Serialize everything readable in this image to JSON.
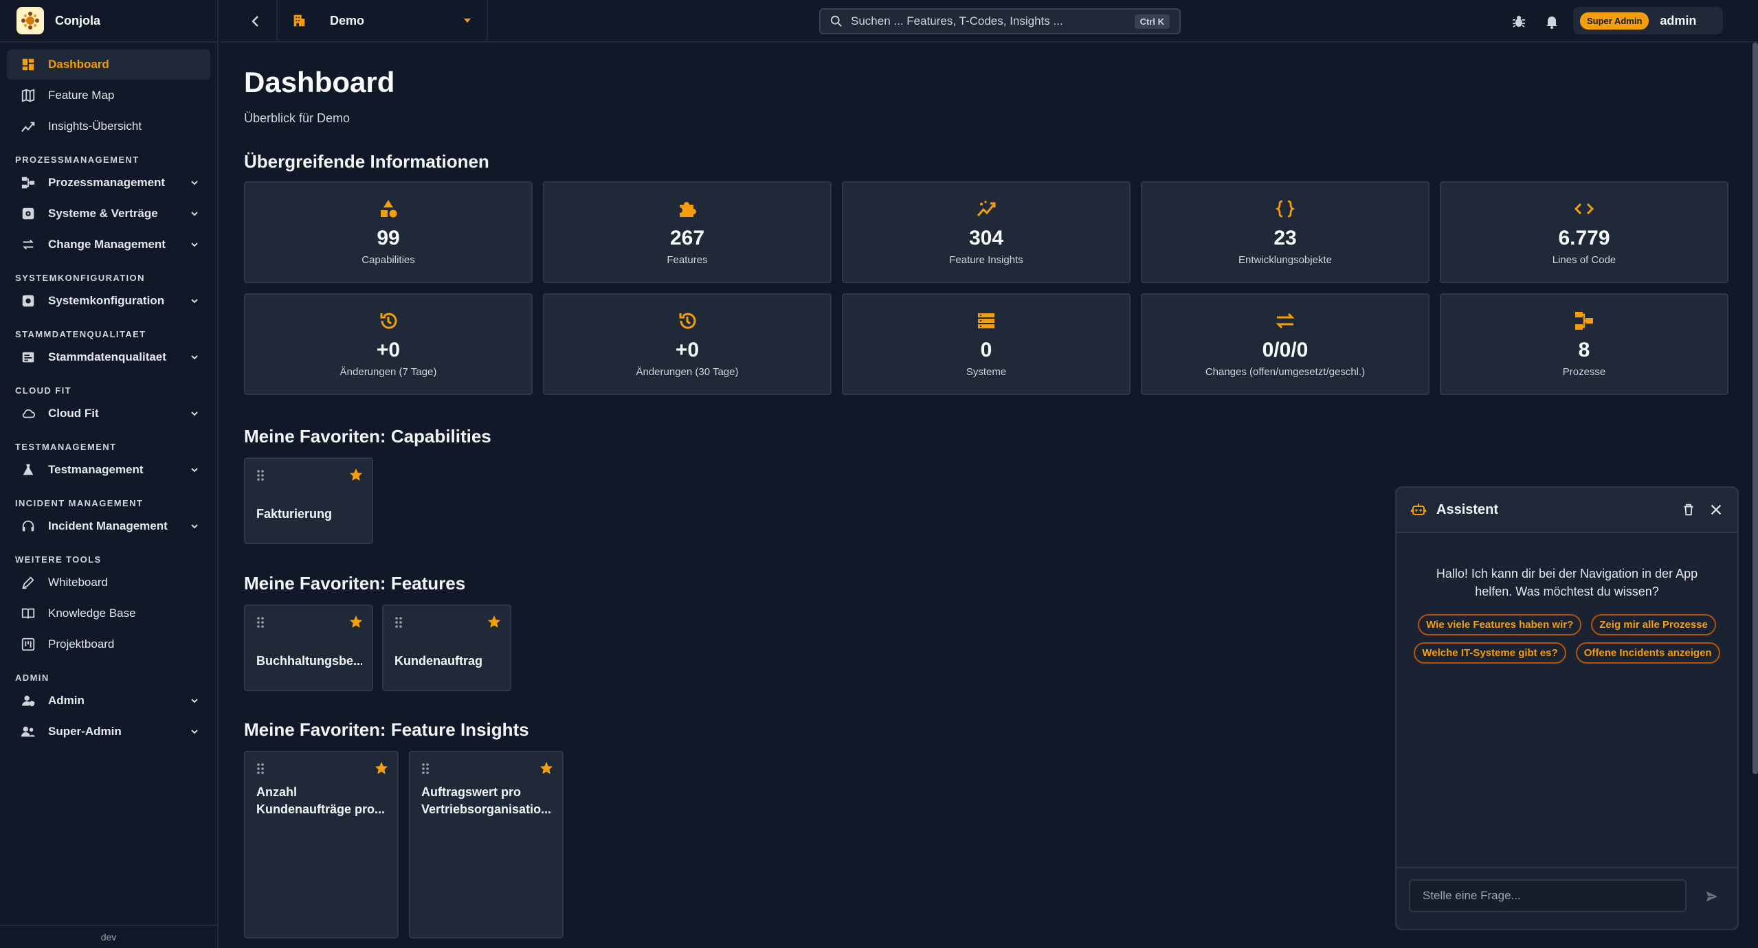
{
  "brand": {
    "name": "Conjola"
  },
  "colors": {
    "accent": "#f59e0b",
    "background": "#111827",
    "card": "#1f2937"
  },
  "sidebar": {
    "top_items": [
      {
        "label": "Dashboard",
        "icon": "dashboard-icon",
        "active": true
      },
      {
        "label": "Feature Map",
        "icon": "map-icon"
      },
      {
        "label": "Insights-Übersicht",
        "icon": "chart-line-icon"
      }
    ],
    "sections": [
      {
        "title": "PROZESSMANAGEMENT",
        "items": [
          {
            "label": "Prozessmanagement",
            "icon": "process-icon"
          },
          {
            "label": "Systeme & Verträge",
            "icon": "system-icon"
          },
          {
            "label": "Change Management",
            "icon": "swap-icon"
          }
        ]
      },
      {
        "title": "SYSTEMKONFIGURATION",
        "items": [
          {
            "label": "Systemkonfiguration",
            "icon": "config-icon"
          }
        ]
      },
      {
        "title": "STAMMDATENQUALITAET",
        "items": [
          {
            "label": "Stammdatenqualitaet",
            "icon": "data-quality-icon"
          }
        ]
      },
      {
        "title": "CLOUD FIT",
        "items": [
          {
            "label": "Cloud Fit",
            "icon": "cloud-icon"
          }
        ]
      },
      {
        "title": "TESTMANAGEMENT",
        "items": [
          {
            "label": "Testmanagement",
            "icon": "flask-icon"
          }
        ]
      },
      {
        "title": "INCIDENT MANAGEMENT",
        "items": [
          {
            "label": "Incident Management",
            "icon": "headset-icon"
          }
        ]
      },
      {
        "title": "WEITERE TOOLS",
        "simple": true,
        "items": [
          {
            "label": "Whiteboard",
            "icon": "pen-icon"
          },
          {
            "label": "Knowledge Base",
            "icon": "book-icon"
          },
          {
            "label": "Projektboard",
            "icon": "board-icon"
          }
        ]
      },
      {
        "title": "ADMIN",
        "items": [
          {
            "label": "Admin",
            "icon": "shield-user-icon"
          },
          {
            "label": "Super-Admin",
            "icon": "users-icon"
          }
        ]
      }
    ],
    "footer": "dev"
  },
  "topbar": {
    "project": "Demo",
    "search_placeholder": "Suchen ... Features, T-Codes, Insights ...",
    "search_shortcut": "Ctrl K",
    "role_badge": "Super Admin",
    "username": "admin"
  },
  "main": {
    "title": "Dashboard",
    "subtitle": "Überblick für Demo",
    "overview_title": "Übergreifende Informationen",
    "stats": [
      {
        "value": "99",
        "label": "Capabilities",
        "icon": "shapes-icon"
      },
      {
        "value": "267",
        "label": "Features",
        "icon": "puzzle-icon"
      },
      {
        "value": "304",
        "label": "Feature Insights",
        "icon": "insights-icon"
      },
      {
        "value": "23",
        "label": "Entwicklungsobjekte",
        "icon": "braces-icon"
      },
      {
        "value": "6.779",
        "label": "Lines of Code",
        "icon": "code-icon"
      },
      {
        "value": "+0",
        "label": "Änderungen (7 Tage)",
        "icon": "history-icon"
      },
      {
        "value": "+0",
        "label": "Änderungen (30 Tage)",
        "icon": "history-icon"
      },
      {
        "value": "0",
        "label": "Systeme",
        "icon": "server-icon"
      },
      {
        "value": "0/0/0",
        "label": "Changes (offen/umgesetzt/geschl.)",
        "icon": "swap-icon"
      },
      {
        "value": "8",
        "label": "Prozesse",
        "icon": "process-icon"
      }
    ],
    "fav_capabilities": {
      "title": "Meine Favoriten: Capabilities",
      "items": [
        "Fakturierung"
      ]
    },
    "fav_features": {
      "title": "Meine Favoriten: Features",
      "items": [
        "Buchhaltungsbe...",
        "Kundenauftrag"
      ]
    },
    "fav_insights": {
      "title": "Meine Favoriten: Feature Insights",
      "items": [
        "Anzahl Kundenaufträge pro...",
        "Auftragswert pro Vertriebsorganisatio..."
      ]
    }
  },
  "assistant": {
    "title": "Assistent",
    "greeting": "Hallo! Ich kann dir bei der Navigation in der App helfen. Was möchtest du wissen?",
    "suggestions": [
      "Wie viele Features haben wir?",
      "Zeig mir alle Prozesse",
      "Welche IT-Systeme gibt es?",
      "Offene Incidents anzeigen"
    ],
    "input_placeholder": "Stelle eine Frage..."
  }
}
